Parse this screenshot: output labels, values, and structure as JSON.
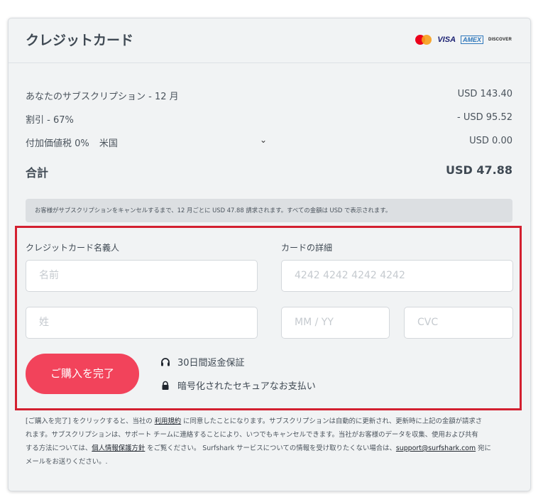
{
  "header": {
    "title": "クレジットカード",
    "brands": {
      "visa": "VISA",
      "amex": "AMEX",
      "discover": "DISCOVER"
    }
  },
  "summary": {
    "subscription": {
      "label": "あなたのサブスクリプション - 12 月",
      "amount": "USD 143.40"
    },
    "discount": {
      "label": "割引 - 67%",
      "amount": "- USD 95.52"
    },
    "vat": {
      "label": "付加価値税 0%",
      "country": "米国",
      "amount": "USD 0.00"
    },
    "total": {
      "label": "合計",
      "amount": "USD 47.88"
    }
  },
  "billing_note": "お客様がサブスクリプションをキャンセルするまで、12 月ごとに USD 47.88 請求されます。すべての金額は USD で表示されます。",
  "form": {
    "name_section_label": "クレジットカード名義人",
    "card_section_label": "カードの詳細",
    "first_name_placeholder": "名前",
    "last_name_placeholder": "姓",
    "card_number_placeholder": "4242 4242 4242 4242",
    "expiry_placeholder": "MM / YY",
    "cvc_placeholder": "CVC",
    "submit_label": "ご購入を完了",
    "features": [
      "30日間返金保証",
      "暗号化されたセキュアなお支払い"
    ]
  },
  "legal": {
    "line1_a": "[ご購入を完了] をクリックすると、当社の ",
    "terms_link": "利用規約",
    "line1_b": " に同意したことになります。サブスクリプションは自動的に更新され、更新時に上記の金額が請求さ",
    "line2": "れます。サブスクリプションは、サポート チームに連絡することにより、いつでもキャンセルできます。当社がお客様のデータを収集、使用および共有",
    "line3_a": "する方法については、",
    "privacy_link": "個人情報保護方針",
    "line3_b": " をご覧ください。 Surfshark サービスについての情報を受け取りたくない場合は、",
    "email_link": "support@surfshark.com",
    "line3_c": " 宛に",
    "line4": "メールをお送りください。."
  },
  "colors": {
    "accent": "#f2435b",
    "highlight_border": "#d32030"
  }
}
